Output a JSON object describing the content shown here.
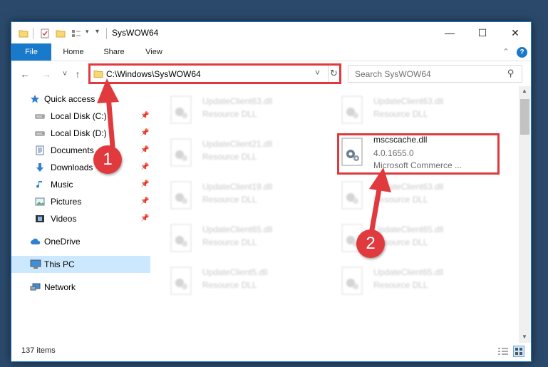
{
  "window": {
    "title": "SysWOW64",
    "controls": {
      "minimize": "—",
      "maximize": "☐",
      "close": "✕"
    }
  },
  "ribbon": {
    "tabs": [
      "File",
      "Home",
      "Share",
      "View"
    ],
    "collapse_glyph": "⌃",
    "help_glyph": "?"
  },
  "nav": {
    "back": "←",
    "forward": "→",
    "recent": "˅",
    "up": "↑",
    "address": "C:\\Windows\\SysWOW64",
    "dropdown": "˅",
    "refresh": "↻",
    "search_placeholder": "Search SysWOW64",
    "search_glyph": "⚲"
  },
  "sidebar": {
    "items": [
      {
        "label": "Quick access",
        "icon": "star-icon",
        "pinned": false
      },
      {
        "label": "Local Disk (C:)",
        "icon": "drive-icon",
        "pinned": true
      },
      {
        "label": "Local Disk (D:)",
        "icon": "drive-icon",
        "pinned": true
      },
      {
        "label": "Documents",
        "icon": "documents-icon",
        "pinned": true
      },
      {
        "label": "Downloads",
        "icon": "downloads-icon",
        "pinned": true
      },
      {
        "label": "Music",
        "icon": "music-icon",
        "pinned": true
      },
      {
        "label": "Pictures",
        "icon": "pictures-icon",
        "pinned": true
      },
      {
        "label": "Videos",
        "icon": "videos-icon",
        "pinned": true
      },
      {
        "label": "OneDrive",
        "icon": "cloud-icon",
        "pinned": false
      },
      {
        "label": "This PC",
        "icon": "computer-icon",
        "pinned": false,
        "selected": true
      },
      {
        "label": "Network",
        "icon": "network-icon",
        "pinned": false
      }
    ],
    "pin_glyph": "📌"
  },
  "files": {
    "left": [
      {
        "name": "UpdateClient63.dll",
        "desc": "Resource DLL"
      },
      {
        "name": "UpdateClient21.dll",
        "desc": "Resource DLL"
      },
      {
        "name": "UpdateClient19.dll",
        "desc": "Resource DLL"
      },
      {
        "name": "UpdateClient65.dll",
        "desc": "Resource DLL"
      },
      {
        "name": "UpdateClient5.dll",
        "desc": "Resource DLL"
      }
    ],
    "right": [
      {
        "name": "UpdateClient63.dll",
        "desc": "Resource DLL"
      },
      {
        "name": "UpdateClient63.dll",
        "desc": "Resource DLL"
      },
      {
        "name": "UpdateClient65.dll",
        "desc": "Resource DLL"
      },
      {
        "name": "UpdateClient65.dll",
        "desc": "Resource DLL"
      }
    ],
    "highlighted": {
      "name": "mscscache.dll",
      "version": "4.0.1655.0",
      "company": "Microsoft Commerce ..."
    }
  },
  "status": {
    "count": "137 items"
  },
  "annotations": {
    "step1": "1",
    "step2": "2",
    "color": "#e0393e"
  }
}
